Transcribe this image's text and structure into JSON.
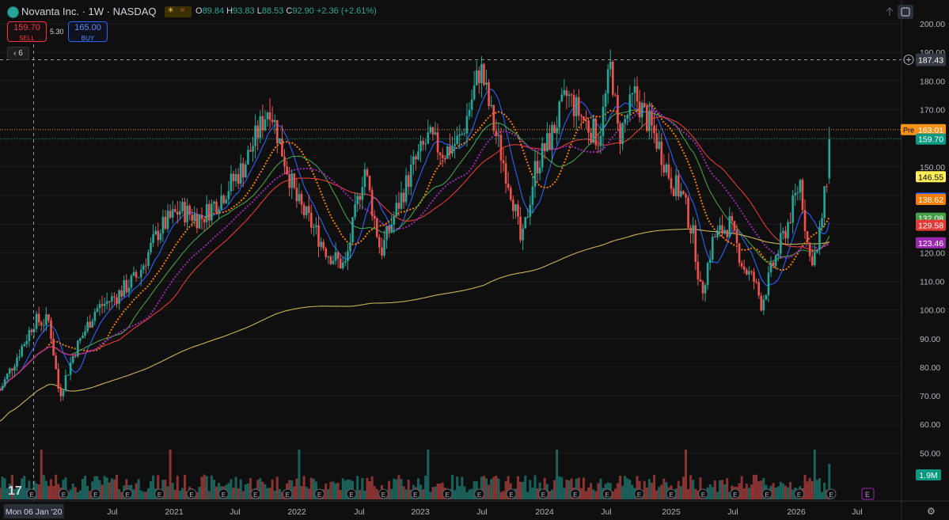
{
  "header": {
    "title": "Novanta Inc. · 1W · NASDAQ",
    "ohlc": [
      {
        "k": "O",
        "v": "89.84"
      },
      {
        "k": "H",
        "v": "93.83"
      },
      {
        "k": "L",
        "v": "88.53"
      },
      {
        "k": "C",
        "v": "92.90"
      }
    ],
    "change": "+2.36 (+2.61%)"
  },
  "trade": {
    "sell_price": "159.70",
    "sell_label": "SELL",
    "spread": "5.30",
    "buy_price": "165.00",
    "buy_label": "BUY"
  },
  "collapse_count": "6",
  "price_axis": {
    "ticks": [
      "200.00",
      "190.00",
      "180.00",
      "170.00",
      "160.00",
      "150.00",
      "140.00",
      "130.00",
      "120.00",
      "110.00",
      "100.00",
      "90.00",
      "80.00",
      "70.00",
      "60.00",
      "50.00"
    ]
  },
  "crosshair_label": "187.43",
  "price_tags": [
    {
      "text": "163.01",
      "prefix": "Pre",
      "color": "#f7931a",
      "value": 163.01
    },
    {
      "text": "159.70",
      "color": "#089981",
      "value": 159.7
    },
    {
      "text": "146.55",
      "color": "#ffee58",
      "text_color": "#000000",
      "value": 146.55
    },
    {
      "text": "139.04",
      "color": "#2962ff",
      "value": 139.04
    },
    {
      "text": "138.62",
      "color": "#f57c00",
      "value": 138.62
    },
    {
      "text": "132.08",
      "color": "#43a047",
      "value": 132.08
    },
    {
      "text": "129.58",
      "color": "#e53935",
      "value": 129.58
    },
    {
      "text": "123.46",
      "color": "#9c27b0",
      "value": 123.46
    }
  ],
  "volume_tag": "1.9M",
  "time_axis": {
    "crosshair_label": "Mon 06 Jan '20",
    "labels": [
      "Jul",
      "2021",
      "Jul",
      "2022",
      "Jul",
      "2023",
      "Jul",
      "2024",
      "Jul",
      "2025",
      "Jul",
      "2026",
      "Jul"
    ]
  },
  "event_marker": "E",
  "tv_logo": "17",
  "colors": {
    "up": "#26a69a",
    "down": "#ef5350",
    "bg": "#0f0f0f",
    "grid": "#1c1c1c"
  },
  "icons": {
    "symbol": "novanta-logo-icon",
    "settings": "gear-icon",
    "scroll": "arrow-up-icon",
    "fullscreen": "fullscreen-icon"
  },
  "chart_data": {
    "type": "candlestick",
    "interval": "1W",
    "x_range": [
      "2019-10",
      "2026-07"
    ],
    "ylim": [
      50,
      200
    ],
    "anchors": [
      [
        "2019-10-01",
        72
      ],
      [
        "2019-12-15",
        90
      ],
      [
        "2020-01-06",
        96
      ],
      [
        "2020-02-20",
        96
      ],
      [
        "2020-03-20",
        70
      ],
      [
        "2020-05-01",
        85
      ],
      [
        "2020-07-01",
        100
      ],
      [
        "2020-09-01",
        105
      ],
      [
        "2020-11-01",
        112
      ],
      [
        "2021-01-01",
        128
      ],
      [
        "2021-03-01",
        135
      ],
      [
        "2021-05-01",
        132
      ],
      [
        "2021-07-01",
        140
      ],
      [
        "2021-09-01",
        150
      ],
      [
        "2021-11-15",
        172
      ],
      [
        "2021-12-15",
        158
      ],
      [
        "2022-02-01",
        138
      ],
      [
        "2022-03-15",
        130
      ],
      [
        "2022-05-01",
        120
      ],
      [
        "2022-06-20",
        115
      ],
      [
        "2022-08-15",
        150
      ],
      [
        "2022-10-01",
        120
      ],
      [
        "2022-11-15",
        135
      ],
      [
        "2023-01-01",
        150
      ],
      [
        "2023-02-15",
        160
      ],
      [
        "2023-04-01",
        155
      ],
      [
        "2023-05-20",
        160
      ],
      [
        "2023-07-15",
        185
      ],
      [
        "2023-08-20",
        165
      ],
      [
        "2023-10-15",
        140
      ],
      [
        "2023-11-10",
        122
      ],
      [
        "2023-12-20",
        150
      ],
      [
        "2024-02-01",
        160
      ],
      [
        "2024-03-20",
        175
      ],
      [
        "2024-05-15",
        165
      ],
      [
        "2024-06-20",
        160
      ],
      [
        "2024-07-25",
        186
      ],
      [
        "2024-08-15",
        160
      ],
      [
        "2024-10-01",
        175
      ],
      [
        "2024-12-01",
        160
      ],
      [
        "2025-01-15",
        145
      ],
      [
        "2025-02-15",
        140
      ],
      [
        "2025-03-20",
        125
      ],
      [
        "2025-04-10",
        105
      ],
      [
        "2025-05-15",
        125
      ],
      [
        "2025-07-01",
        130
      ],
      [
        "2025-08-10",
        115
      ],
      [
        "2025-09-10",
        110
      ],
      [
        "2025-10-01",
        102
      ],
      [
        "2025-11-01",
        115
      ],
      [
        "2025-12-15",
        130
      ],
      [
        "2026-01-20",
        145
      ],
      [
        "2026-02-15",
        118
      ],
      [
        "2026-03-10",
        120
      ],
      [
        "2026-04-01",
        140
      ],
      [
        "2026-04-20",
        159.7
      ]
    ],
    "moving_averages": [
      {
        "color": "#2962ff",
        "last": 139.04
      },
      {
        "color": "#f57c00",
        "last": 138.62
      },
      {
        "color": "#43a047",
        "last": 132.08
      },
      {
        "color": "#e53935",
        "last": 129.58
      },
      {
        "color": "#9c27b0",
        "last": 123.46
      },
      {
        "color": "#c9b458",
        "last": 146.55
      }
    ],
    "volume_last": "1.9M",
    "crosshair": {
      "date": "2020-01-06",
      "price": 187.43
    }
  }
}
